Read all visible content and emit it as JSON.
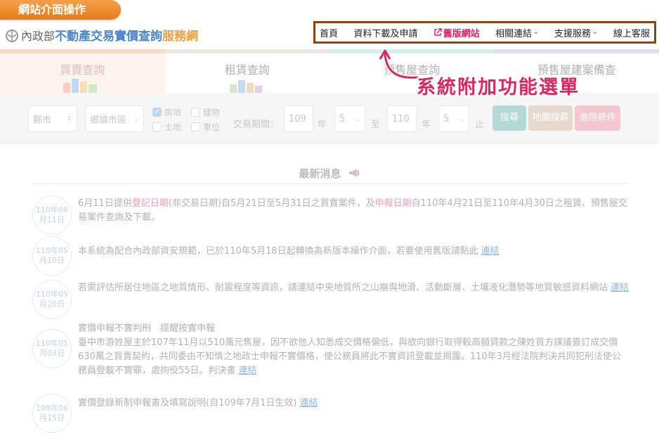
{
  "tag": {
    "label": "網站介面操作"
  },
  "logo": {
    "ministry": "內政部",
    "main": "不動產交易實價查詢",
    "sub": "服務網"
  },
  "nav": {
    "home": "首頁",
    "downloads": "資料下載及申請",
    "old_site": "舊版網站",
    "links": "相關連結",
    "support": "支援服務",
    "service": "線上客服"
  },
  "tabs": [
    "買賣查詢",
    "租賃查詢",
    "預售屋查詢",
    "預售屋建案備查"
  ],
  "callout": "系統附加功能選單",
  "search": {
    "city": "縣市",
    "district": "鄉鎮市區",
    "chk_house": "房地",
    "chk_building": "建物",
    "chk_land": "土地",
    "chk_parking": "車位",
    "period_label": "交易期間：",
    "from_year": "109",
    "year1": "年",
    "from_month": "5",
    "to": "至",
    "to_year": "110",
    "year2": "年",
    "to_month": "5",
    "end": "止",
    "btn_search": "搜尋",
    "btn_map": "地圖搜尋",
    "btn_advanced": "進階條件"
  },
  "news": {
    "title": "最新消息",
    "items": [
      {
        "date1": "110年06",
        "date2": "月11日",
        "p1": "6月11日提供",
        "h1": "登記日期",
        "p2": "(非交易日期)自5月21日至5月31日之買賣案件，及",
        "h2": "申報日期",
        "p3": "自110年4月21日至110年4月30日之租賃、預售屋交易案件查詢及下載。"
      },
      {
        "date1": "110年05",
        "date2": "月10日",
        "text": "本系統為配合內政部資安規範，已於110年5月18日起轉換為新版本操作介面，若要使用舊版請點此",
        "link": "連結"
      },
      {
        "date1": "110年05",
        "date2": "月20日",
        "text": "若需評估所居住地區之地質情形、耐震程度等資訊，請連結中央地質所之山崩與地滑、活動斷層、土壤液化潛勢等地質敏感資料網站",
        "link": "連結"
      },
      {
        "date1": "110年05",
        "date2": "月03日",
        "heading": "實價申報不實判刑　提醒按實申報",
        "text": "臺中市游姓屋主於107年11月以510萬元售屋，因不欲他人知悉成交價格偏低，與欲向銀行取得較高額貸款之陳姓買方謀議簽訂成交價630萬之買賣契約，共同委由不知情之地政士申報不實價格，使公務員將此不實資訊登載並揭露。110年3月經法院判決共同犯刑法使公務員登載不實罪，處拘役55日。判決書",
        "link": "連結"
      },
      {
        "date1": "109年06",
        "date2": "月15日",
        "text": "實價登錄新制申報書及填寫說明(自109年7月1日生效)",
        "link": "連結"
      }
    ]
  }
}
